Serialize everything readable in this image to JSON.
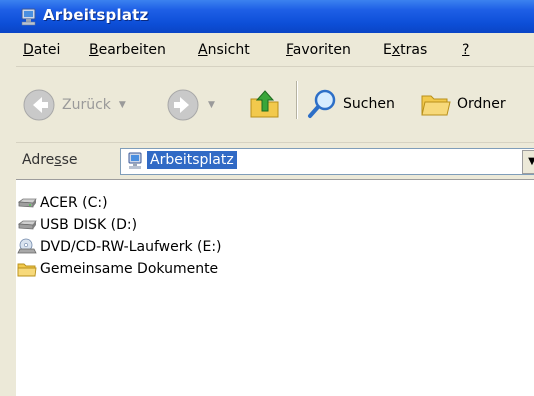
{
  "window": {
    "title": "Arbeitsplatz"
  },
  "menu": {
    "items": [
      {
        "label": "Datei"
      },
      {
        "label": "Bearbeiten"
      },
      {
        "label": "Ansicht"
      },
      {
        "label": "Favoriten"
      },
      {
        "label": "Extras"
      },
      {
        "label": "?"
      }
    ]
  },
  "toolbar": {
    "back_label": "Zurück",
    "search_label": "Suchen",
    "folders_label": "Ordner"
  },
  "address": {
    "label": "Adresse",
    "value": "Arbeitsplatz"
  },
  "items": [
    {
      "label": "ACER (C:)",
      "icon": "hard-drive-icon"
    },
    {
      "label": "USB DISK (D:)",
      "icon": "hard-drive-icon"
    },
    {
      "label": "DVD/CD-RW-Laufwerk (E:)",
      "icon": "cd-drive-icon"
    },
    {
      "label": "Gemeinsame Dokumente",
      "icon": "folder-icon"
    }
  ],
  "colors": {
    "titlebar": "#0d4fd8",
    "chrome": "#ece9d8",
    "selection": "#316ac5"
  }
}
